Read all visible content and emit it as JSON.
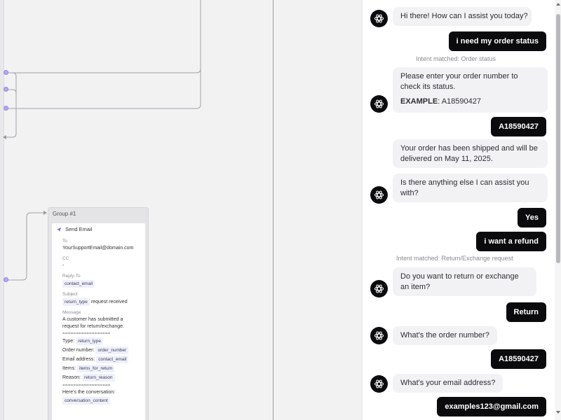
{
  "group": {
    "title": "Group #1",
    "node_title": "Send Email",
    "to_label": "To",
    "to_value": "YourSupportEmail@domain.com",
    "cc_label": "CC",
    "cc_value": "-",
    "reply_to_label": "Reply-To",
    "reply_to_chip": "contact_email",
    "subject_label": "Subject",
    "subject_chip": "return_type",
    "subject_text": "request received",
    "message_label": "Message",
    "message_intro_1": "A customer has submitted a",
    "message_intro_2": "request for return/exchange.",
    "separator": "==================",
    "type_label": "Type:",
    "type_chip": "return_type",
    "order_label": "Order number:",
    "order_chip": "order_number",
    "email_label": "Email address:",
    "email_chip": "contact_email",
    "items_label": "Items:",
    "items_chip": "items_for_return",
    "reason_label": "Reason:",
    "reason_chip": "return_reason",
    "conversation_label": "Here's the conversation:",
    "conversation_chip": "conversation_content"
  },
  "chat": {
    "messages": [
      {
        "role": "bot",
        "text": "Hi there! How can I assist you today?"
      },
      {
        "role": "user",
        "text": "i need my order status"
      },
      {
        "role": "intent",
        "text": "Intent matched: Order status"
      },
      {
        "role": "bot",
        "text": "Please enter your order number to check its status.",
        "example_label": "EXAMPLE",
        "example_value": ": A18590427"
      },
      {
        "role": "user",
        "text": "A18590427"
      },
      {
        "role": "bot",
        "text": "Your order has been shipped and will be delivered on May 11, 2025."
      },
      {
        "role": "bot",
        "text": "Is there anything else I can assist you with?"
      },
      {
        "role": "user",
        "text": "Yes"
      },
      {
        "role": "user",
        "text": "i want a refund"
      },
      {
        "role": "intent",
        "text": "Intent matched: Return/Exchange request"
      },
      {
        "role": "bot",
        "text": "Do you want to return or exchange an item?"
      },
      {
        "role": "user",
        "text": "Return"
      },
      {
        "role": "bot",
        "text": "What's the order number?"
      },
      {
        "role": "user",
        "text": "A18590427"
      },
      {
        "role": "bot",
        "text": "What's your email address?"
      },
      {
        "role": "user",
        "text": "examples123@gmail.com"
      }
    ]
  },
  "icons": {
    "bot_avatar": "atom-icon",
    "send_email": "paper-plane-icon"
  },
  "colors": {
    "user_bubble": "#0b0b0d",
    "bot_bubble": "#f2f2f5",
    "port": "#b6a8f0",
    "chip_bg": "#eef0fb"
  }
}
